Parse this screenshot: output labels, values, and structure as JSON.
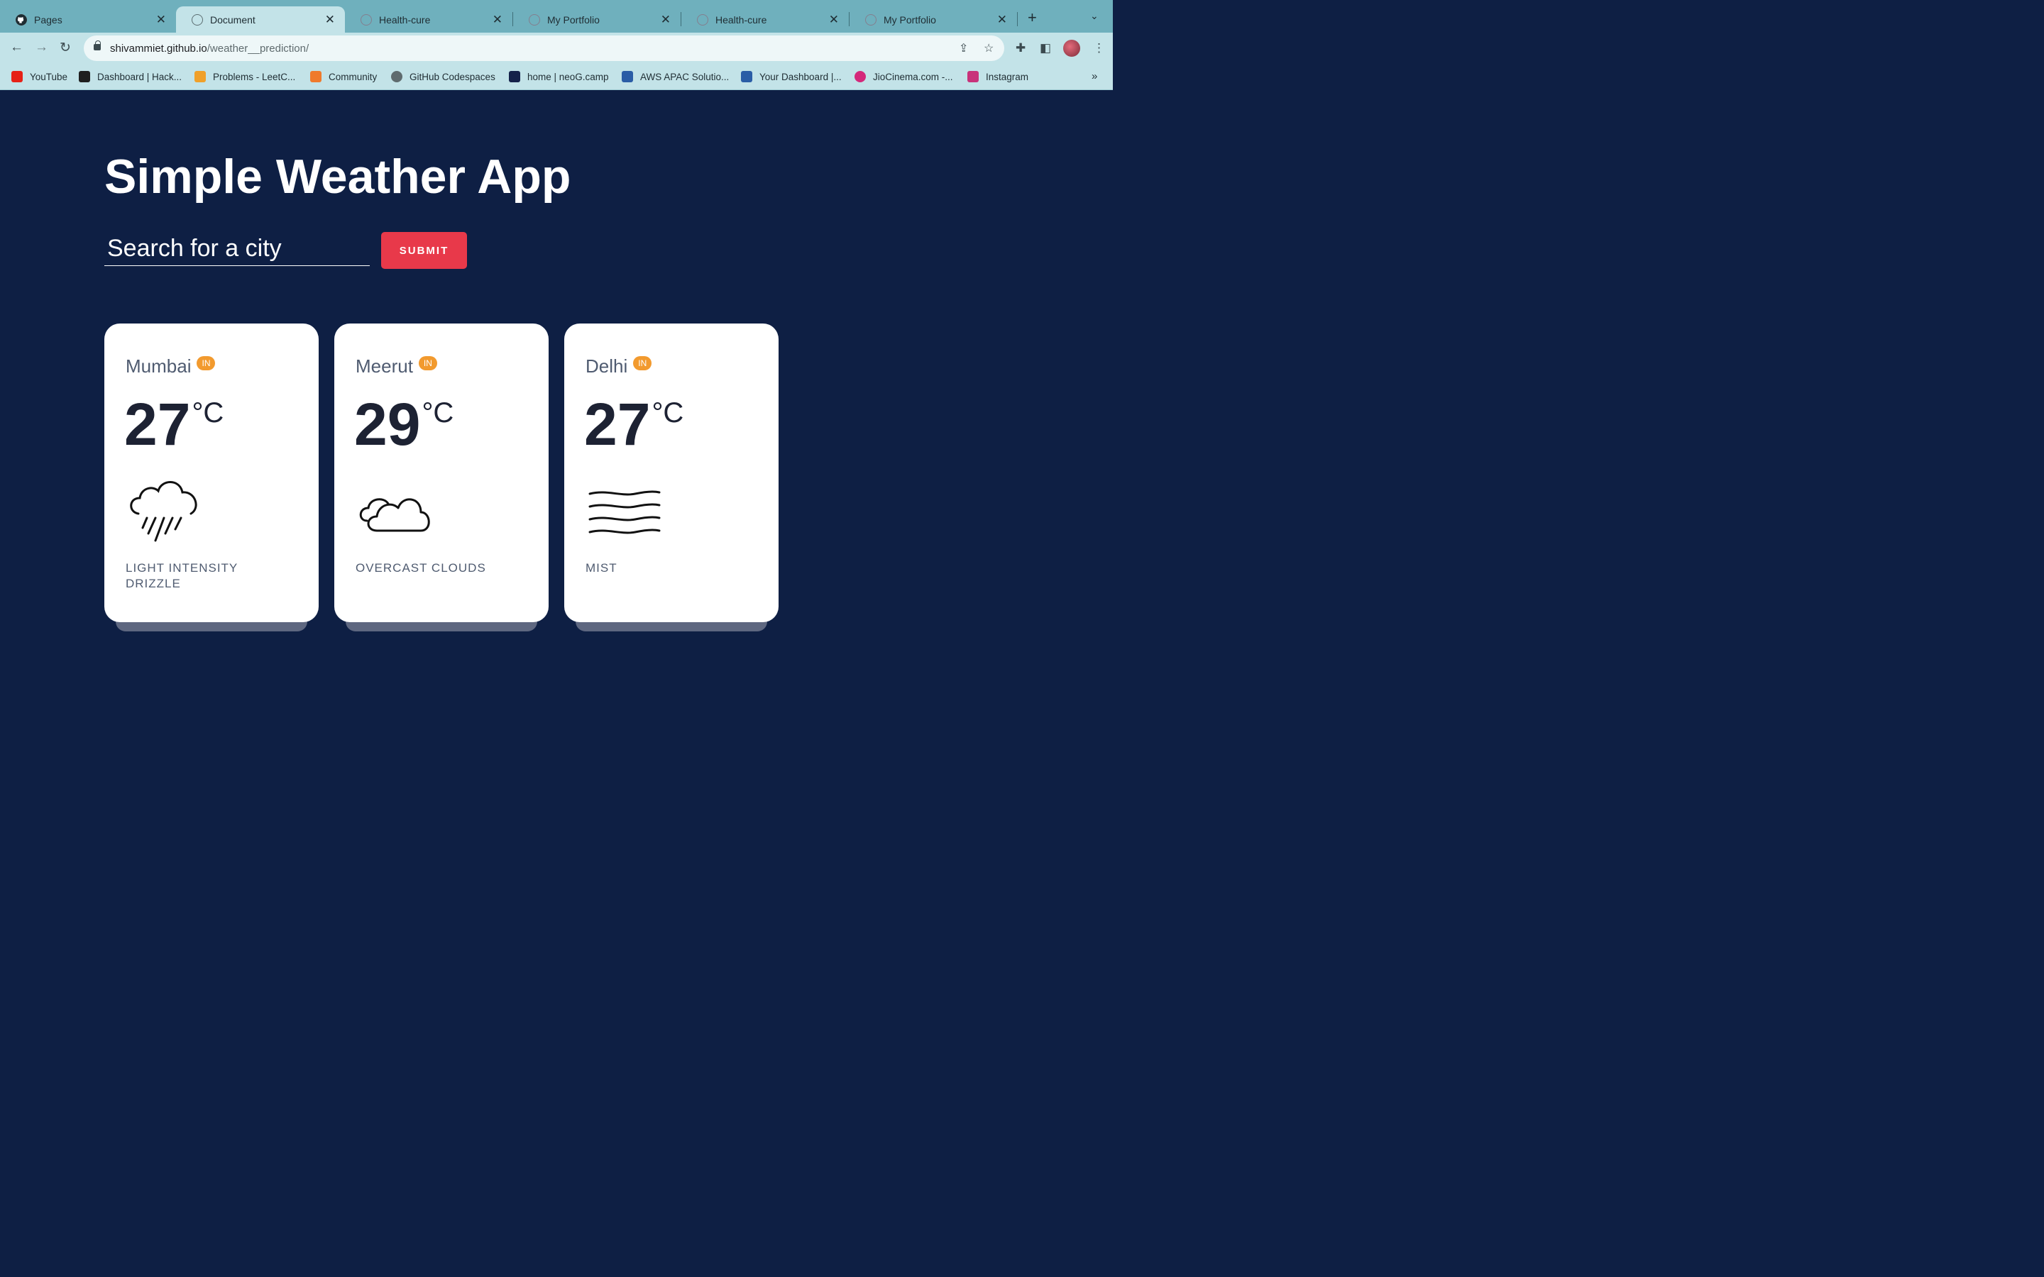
{
  "browser": {
    "tabs": [
      {
        "title": "Pages",
        "favicon": "github-icon",
        "active": false
      },
      {
        "title": "Document",
        "favicon": "globe-icon",
        "active": true
      },
      {
        "title": "Health-cure",
        "favicon": "loading-icon",
        "active": false
      },
      {
        "title": "My Portfolio",
        "favicon": "loading-icon",
        "active": false
      },
      {
        "title": "Health-cure",
        "favicon": "loading-icon",
        "active": false
      },
      {
        "title": "My Portfolio",
        "favicon": "loading-icon",
        "active": false
      }
    ],
    "url_host": "shivammiet.github.io",
    "url_path": "/weather__prediction/",
    "bookmarks": [
      {
        "label": "YouTube",
        "color": "#e62117"
      },
      {
        "label": "Dashboard | Hack...",
        "color": "#1f1f1f"
      },
      {
        "label": "Problems - LeetC...",
        "color": "#f0a029"
      },
      {
        "label": "Community",
        "color": "#ef7a2c"
      },
      {
        "label": "GitHub Codespaces",
        "color": "#5f6b6e"
      },
      {
        "label": "home | neoG.camp",
        "color": "#15224a"
      },
      {
        "label": "AWS APAC Solutio...",
        "color": "#2a5da6"
      },
      {
        "label": "Your Dashboard |...",
        "color": "#2a5da6"
      },
      {
        "label": "JioCinema.com -...",
        "color": "#d4287a"
      },
      {
        "label": "Instagram",
        "color": "#c8327a"
      }
    ]
  },
  "app": {
    "title": "Simple Weather App",
    "search_placeholder": "Search for a city",
    "submit_label": "SUBMIT",
    "cities": [
      {
        "name": "Mumbai",
        "country": "IN",
        "temp": "27",
        "unit": "°C",
        "description": "LIGHT INTENSITY DRIZZLE",
        "icon": "rain-cloud-icon"
      },
      {
        "name": "Meerut",
        "country": "IN",
        "temp": "29",
        "unit": "°C",
        "description": "OVERCAST CLOUDS",
        "icon": "clouds-icon"
      },
      {
        "name": "Delhi",
        "country": "IN",
        "temp": "27",
        "unit": "°C",
        "description": "MIST",
        "icon": "mist-icon"
      }
    ]
  }
}
